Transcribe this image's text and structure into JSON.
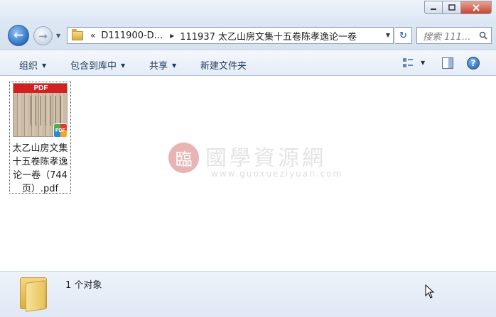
{
  "window": {
    "minimize_icon": "minimize-icon",
    "maximize_icon": "maximize-icon",
    "close_icon": "close-icon"
  },
  "nav": {
    "back_glyph": "←",
    "forward_glyph": "→",
    "history_glyph": "▼"
  },
  "address": {
    "chevrons": "«",
    "crumbs": [
      "D111900-D...",
      "111937 太乙山房文集十五卷陈孝逸论一卷"
    ],
    "separator": "▶",
    "dropdown_glyph": "▼"
  },
  "refresh_glyph": "↻",
  "search": {
    "placeholder": "搜索 111..."
  },
  "commands": {
    "organize": "组织",
    "include_library": "包含到库中",
    "share": "共享",
    "new_folder": "新建文件夹",
    "arrow": "▼"
  },
  "file": {
    "name": "太乙山房文集十五卷陈孝逸论一卷（744页）.pdf",
    "thumb_label": "PDF",
    "badge_label": "PDF"
  },
  "watermark": {
    "logo_glyph": "臨",
    "title": "國學資源網",
    "url": "www.guoxueziyuan.com"
  },
  "details": {
    "count": "1 个对象"
  },
  "colors": {
    "accent": "#2a6fc4",
    "pdf_red": "#d32020"
  }
}
